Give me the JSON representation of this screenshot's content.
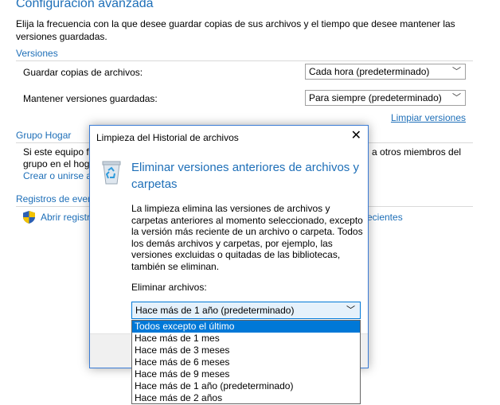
{
  "page": {
    "title": "Configuración avanzada",
    "description": "Elija la frecuencia con la que desee guardar copias de sus archivos y el tiempo que desee mantener las versiones guardadas."
  },
  "versions": {
    "header": "Versiones",
    "save_label": "Guardar copias de archivos:",
    "save_value": "Cada hora (predeterminado)",
    "keep_label": "Mantener versiones guardadas:",
    "keep_value": "Para siempre (predeterminado)",
    "cleanup_link": "Limpiar versiones"
  },
  "homegroup": {
    "header": "Grupo Hogar",
    "text_line1_start": "Si este equipo fo",
    "text_line1_end": "d a otros miembros del",
    "text_line2_start": "grupo en el hog",
    "link_start": "Crear o unirse a"
  },
  "events": {
    "header": "Registros de even",
    "link_start": "Abrir registr",
    "link_end": "recientes"
  },
  "dialog": {
    "title": "Limpieza del Historial de archivos",
    "close_glyph": "✕",
    "heading": "Eliminar versiones anteriores de archivos y carpetas",
    "body": "La limpieza elimina las versiones de archivos y carpetas anteriores al momento seleccionado, excepto la versión más reciente de un archivo o carpeta. Todos los demás archivos y carpetas, por ejemplo, las versiones excluidas o quitadas de las bibliotecas, también se eliminan.",
    "delete_label": "Eliminar archivos:",
    "selected_value": "Hace más de 1 año (predeterminado)",
    "options": [
      "Todos excepto el último",
      "Hace más de 1 mes",
      "Hace más de 3 meses",
      "Hace más de 6 meses",
      "Hace más de 9 meses",
      "Hace más de 1 año (predeterminado)",
      "Hace más de 2 años"
    ],
    "highlighted_index": 0
  },
  "colors": {
    "accent": "#1e6fb8",
    "selection": "#0078d7"
  },
  "icons": {
    "recycle": "recycle-bin-icon",
    "shield": "uac-shield-icon",
    "chevron": "chevron-down-icon"
  }
}
